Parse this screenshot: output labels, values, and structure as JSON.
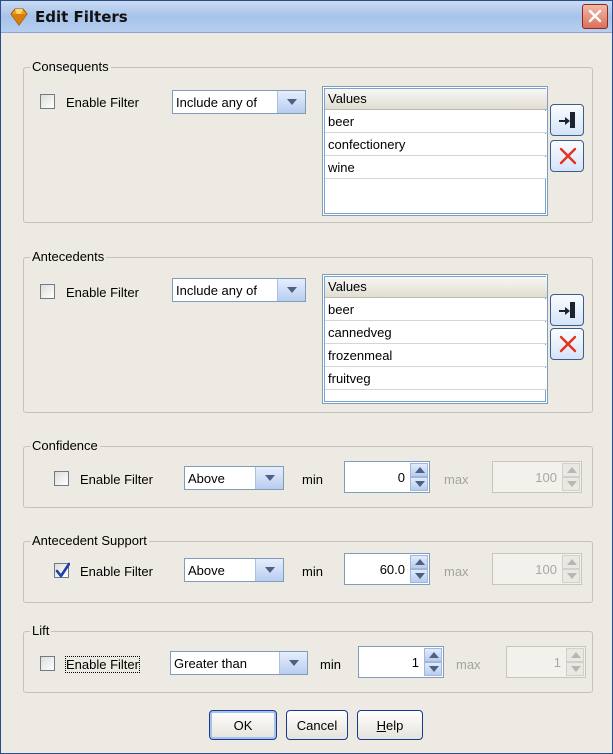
{
  "window": {
    "title": "Edit Filters"
  },
  "consequents": {
    "legend": "Consequents",
    "enable_label": "Enable Filter",
    "enabled": false,
    "mode": "Include any of",
    "values_header": "Values",
    "values": [
      "beer",
      "confectionery",
      "wine"
    ]
  },
  "antecedents": {
    "legend": "Antecedents",
    "enable_label": "Enable Filter",
    "enabled": false,
    "mode": "Include any of",
    "values_header": "Values",
    "values": [
      "beer",
      "cannedveg",
      "frozenmeal",
      "fruitveg"
    ]
  },
  "confidence": {
    "legend": "Confidence",
    "enable_label": "Enable Filter",
    "enabled": false,
    "mode": "Above",
    "min_label": "min",
    "min_value": "0",
    "max_label": "max",
    "max_value": "100"
  },
  "antecedent_support": {
    "legend": "Antecedent Support",
    "enable_label": "Enable Filter",
    "enabled": true,
    "mode": "Above",
    "min_label": "min",
    "min_value": "60.0",
    "max_label": "max",
    "max_value": "100"
  },
  "lift": {
    "legend": "Lift",
    "enable_label": "Enable Filter",
    "enabled": false,
    "mode": "Greater than",
    "min_label": "min",
    "min_value": "1",
    "max_label": "max",
    "max_value": "1"
  },
  "buttons": {
    "ok": "OK",
    "cancel": "Cancel",
    "help_prefix": "H",
    "help_rest": "elp"
  },
  "colors": {
    "accent": "#173a8c",
    "frame": "#2b4d8a",
    "delete_x": "#e0341f"
  }
}
